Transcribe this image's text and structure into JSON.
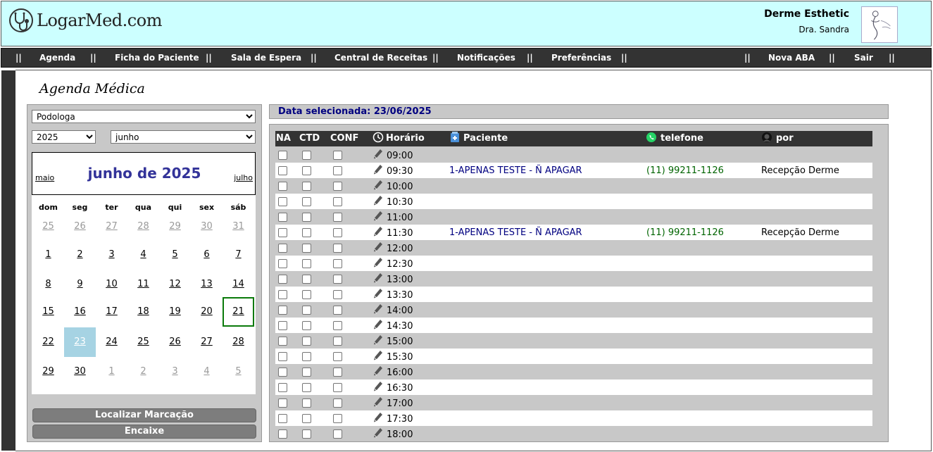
{
  "header": {
    "site_name": "LogarMed.com",
    "logo_icon": "stethoscope-icon",
    "clinic_name": "Derme Esthetic",
    "doctor_name": "Dra. Sandra",
    "clinic_logo_icon": "clinic-logo-icon"
  },
  "nav": {
    "separator": "||",
    "items": [
      "Agenda",
      "Ficha do Paciente",
      "Sala de Espera",
      "Central de Receitas",
      "Notificações",
      "Preferências"
    ],
    "right_items": [
      "Nova ABA",
      "Sair"
    ]
  },
  "page_title": "Agenda Médica",
  "filters": {
    "professional": "Podologa",
    "year": "2025",
    "month": "junho"
  },
  "calendar": {
    "title": "junho de 2025",
    "prev": "maio",
    "next": "julho",
    "weekdays": [
      "dom",
      "seg",
      "ter",
      "qua",
      "qui",
      "sex",
      "sáb"
    ],
    "weeks": [
      [
        "25",
        "26",
        "27",
        "28",
        "29",
        "30",
        "31"
      ],
      [
        "1",
        "2",
        "3",
        "4",
        "5",
        "6",
        "7"
      ],
      [
        "8",
        "9",
        "10",
        "11",
        "12",
        "13",
        "14"
      ],
      [
        "15",
        "16",
        "17",
        "18",
        "19",
        "20",
        "21"
      ],
      [
        "22",
        "23",
        "24",
        "25",
        "26",
        "27",
        "28"
      ],
      [
        "29",
        "30",
        "1",
        "2",
        "3",
        "4",
        "5"
      ]
    ],
    "selected_day": "23",
    "today_day": "21",
    "today_color": "#0a7a0a",
    "selected_color": "#a6d3e3"
  },
  "buttons": {
    "find": "Localizar Marcação",
    "fit": "Encaixe"
  },
  "schedule": {
    "selected_date_label": "Data selecionada: 23/06/2025",
    "columns": {
      "na": "NA",
      "ctd": "CTD",
      "conf": "CONF",
      "time": "Horário",
      "patient": "Paciente",
      "phone": "telefone",
      "by": "por"
    },
    "column_icons": {
      "time": "clock-icon",
      "patient": "patient-card-icon",
      "phone": "whatsapp-icon",
      "by": "user-icon"
    },
    "rows": [
      {
        "time": "09:00",
        "patient": "",
        "phone": "",
        "by": ""
      },
      {
        "time": "09:30",
        "patient": "1-APENAS TESTE - Ñ APAGAR",
        "phone": "(11) 99211-1126",
        "by": "Recepção Derme"
      },
      {
        "time": "10:00",
        "patient": "",
        "phone": "",
        "by": ""
      },
      {
        "time": "10:30",
        "patient": "",
        "phone": "",
        "by": ""
      },
      {
        "time": "11:00",
        "patient": "",
        "phone": "",
        "by": ""
      },
      {
        "time": "11:30",
        "patient": "1-APENAS TESTE - Ñ APAGAR",
        "phone": "(11) 99211-1126",
        "by": "Recepção Derme"
      },
      {
        "time": "12:00",
        "patient": "",
        "phone": "",
        "by": ""
      },
      {
        "time": "12:30",
        "patient": "",
        "phone": "",
        "by": ""
      },
      {
        "time": "13:00",
        "patient": "",
        "phone": "",
        "by": ""
      },
      {
        "time": "13:30",
        "patient": "",
        "phone": "",
        "by": ""
      },
      {
        "time": "14:00",
        "patient": "",
        "phone": "",
        "by": ""
      },
      {
        "time": "14:30",
        "patient": "",
        "phone": "",
        "by": ""
      },
      {
        "time": "15:00",
        "patient": "",
        "phone": "",
        "by": ""
      },
      {
        "time": "15:30",
        "patient": "",
        "phone": "",
        "by": ""
      },
      {
        "time": "16:00",
        "patient": "",
        "phone": "",
        "by": ""
      },
      {
        "time": "16:30",
        "patient": "",
        "phone": "",
        "by": ""
      },
      {
        "time": "17:00",
        "patient": "",
        "phone": "",
        "by": ""
      },
      {
        "time": "17:30",
        "patient": "",
        "phone": "",
        "by": ""
      },
      {
        "time": "18:00",
        "patient": "",
        "phone": "",
        "by": ""
      }
    ]
  }
}
